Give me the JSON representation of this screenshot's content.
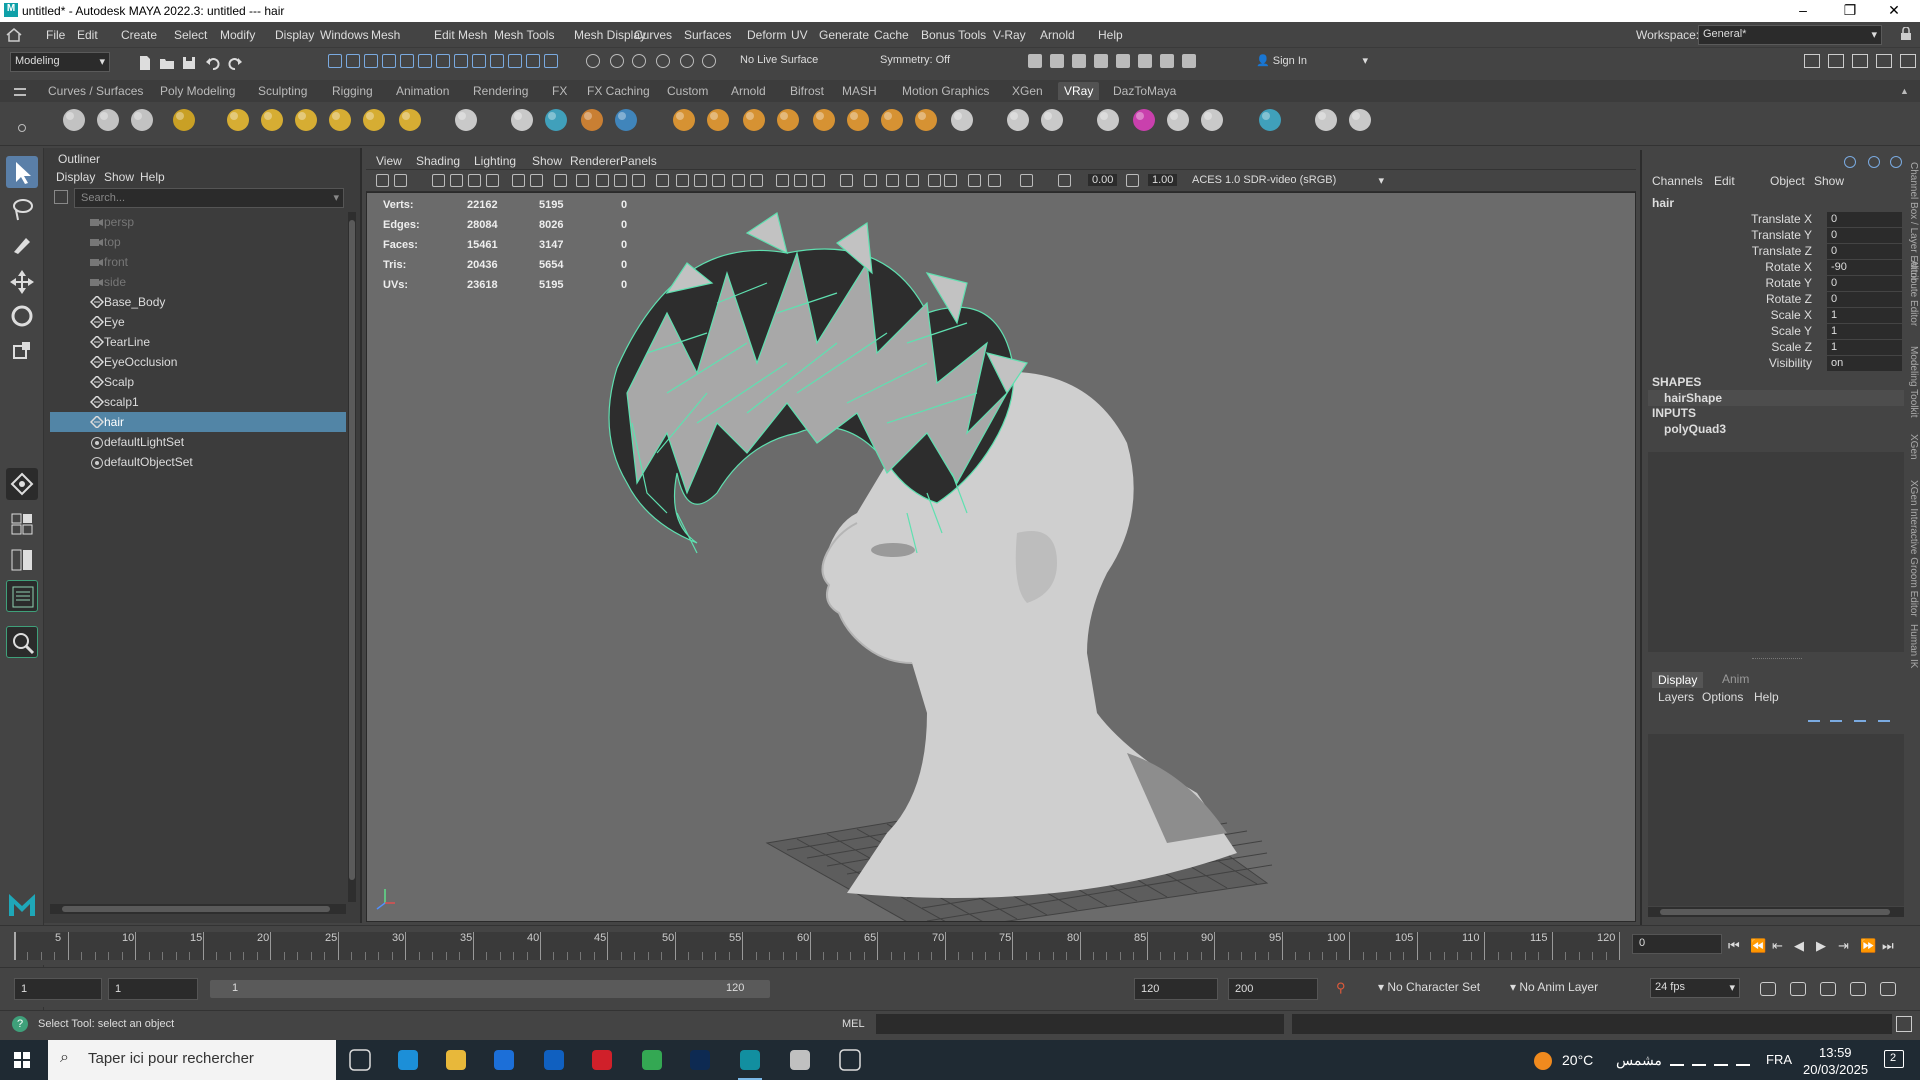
{
  "window": {
    "title": "untitled* - Autodesk MAYA 2022.3: untitled   ---   hair"
  },
  "menubar": {
    "items": [
      "File",
      "Edit",
      "Create",
      "Select",
      "Modify",
      "Display",
      "Windows",
      "Mesh",
      "Edit Mesh",
      "Mesh Tools",
      "Mesh Display",
      "Curves",
      "Surfaces",
      "Deform",
      "UV",
      "Generate",
      "Cache",
      "Bonus Tools",
      "V-Ray",
      "Arnold",
      "Help"
    ],
    "workspace_label": "Workspace:",
    "workspace_value": "General*"
  },
  "statusline": {
    "menuset": "Modeling",
    "live_surface": "No Live Surface",
    "symmetry": "Symmetry: Off",
    "signin": "Sign In"
  },
  "shelf": {
    "tabs": [
      "Curves / Surfaces",
      "Poly Modeling",
      "Sculpting",
      "Rigging",
      "Animation",
      "Rendering",
      "FX",
      "FX Caching",
      "Custom",
      "Arnold",
      "Bifrost",
      "MASH",
      "Motion Graphics",
      "XGen",
      "VRay",
      "DazToMaya"
    ],
    "active_tab": "VRay"
  },
  "outliner": {
    "title": "Outliner",
    "menu": [
      "Display",
      "Show",
      "Help"
    ],
    "search_placeholder": "Search...",
    "items": [
      {
        "label": "persp",
        "type": "camera",
        "dim": true
      },
      {
        "label": "top",
        "type": "camera",
        "dim": true
      },
      {
        "label": "front",
        "type": "camera",
        "dim": true
      },
      {
        "label": "side",
        "type": "camera",
        "dim": true
      },
      {
        "label": "Base_Body",
        "type": "mesh"
      },
      {
        "label": "Eye",
        "type": "mesh"
      },
      {
        "label": "TearLine",
        "type": "mesh"
      },
      {
        "label": "EyeOcclusion",
        "type": "mesh"
      },
      {
        "label": "Scalp",
        "type": "mesh"
      },
      {
        "label": "scalp1",
        "type": "mesh"
      },
      {
        "label": "hair",
        "type": "mesh",
        "selected": true
      },
      {
        "label": "defaultLightSet",
        "type": "set"
      },
      {
        "label": "defaultObjectSet",
        "type": "set"
      }
    ]
  },
  "viewport": {
    "menu": [
      "View",
      "Shading",
      "Lighting",
      "Show",
      "Renderer",
      "Panels"
    ],
    "exposure": "0.00",
    "gamma": "1.00",
    "colorspace": "ACES 1.0 SDR-video (sRGB)",
    "hud": [
      {
        "label": "Verts:",
        "a": "22162",
        "b": "5195",
        "c": "0"
      },
      {
        "label": "Edges:",
        "a": "28084",
        "b": "8026",
        "c": "0"
      },
      {
        "label": "Faces:",
        "a": "15461",
        "b": "3147",
        "c": "0"
      },
      {
        "label": "Tris:",
        "a": "20436",
        "b": "5654",
        "c": "0"
      },
      {
        "label": "UVs:",
        "a": "23618",
        "b": "5195",
        "c": "0"
      }
    ]
  },
  "channelbox": {
    "menu": [
      "Channels",
      "Edit",
      "Object",
      "Show"
    ],
    "object": "hair",
    "attrs": [
      {
        "name": "Translate X",
        "value": "0"
      },
      {
        "name": "Translate Y",
        "value": "0"
      },
      {
        "name": "Translate Z",
        "value": "0"
      },
      {
        "name": "Rotate X",
        "value": "-90"
      },
      {
        "name": "Rotate Y",
        "value": "0"
      },
      {
        "name": "Rotate Z",
        "value": "0"
      },
      {
        "name": "Scale X",
        "value": "1"
      },
      {
        "name": "Scale Y",
        "value": "1"
      },
      {
        "name": "Scale Z",
        "value": "1"
      },
      {
        "name": "Visibility",
        "value": "on"
      }
    ],
    "shapes_header": "SHAPES",
    "shape": "hairShape",
    "inputs_header": "INPUTS",
    "input": "polyQuad3"
  },
  "layers": {
    "tabs": [
      "Display",
      "Anim"
    ],
    "active": "Display",
    "menu": [
      "Layers",
      "Options",
      "Help"
    ]
  },
  "side_tabs": [
    "Channel Box / Layer Editor",
    "Attribute Editor",
    "Modeling Toolkit",
    "XGen",
    "XGen Interactive Groom Editor",
    "Human IK"
  ],
  "timeline": {
    "ticks": [
      "5",
      "10",
      "15",
      "20",
      "25",
      "30",
      "35",
      "40",
      "45",
      "50",
      "55",
      "60",
      "65",
      "70",
      "75",
      "80",
      "85",
      "90",
      "95",
      "100",
      "105",
      "110",
      "115",
      "120"
    ],
    "current_frame": "0"
  },
  "range": {
    "start": "1",
    "start2": "1",
    "range_start": "1",
    "range_end": "120",
    "end": "120",
    "end2": "200",
    "character_set": "No Character Set",
    "anim_layer": "No Anim Layer",
    "fps": "24 fps"
  },
  "commandline": {
    "status": "Select Tool: select an object",
    "lang": "MEL"
  },
  "taskbar": {
    "search_placeholder": "Taper ici pour rechercher",
    "weather": "20°C",
    "weather_text": "مشمس",
    "lang": "FRA",
    "time": "13:59",
    "date": "20/03/2025",
    "notif_count": "2"
  }
}
